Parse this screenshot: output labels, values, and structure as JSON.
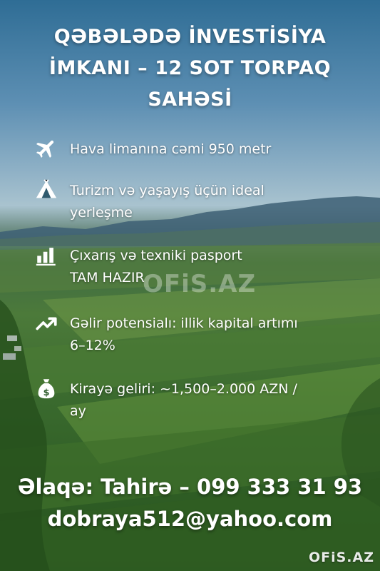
{
  "title": {
    "line1": "QƏBƏLƏDƏ İNVESTİSİYA",
    "line2": "İMKANI – 12 SOT TORPAQ",
    "line3": "SAHƏSİ"
  },
  "features": [
    {
      "icon": "airplane-icon",
      "lines": [
        "Hava limanına cəmi 950 metr"
      ]
    },
    {
      "icon": "tent-icon",
      "lines": [
        "Turizm və yaşayış üçün ideal",
        "yerleşme"
      ]
    },
    {
      "icon": "bar-chart-icon",
      "lines": [
        "Çıxarış və texniki pasport",
        "TAM HAZIR"
      ]
    },
    {
      "icon": "trend-up-icon",
      "lines": [
        "Gəlir potensialı: illik kapital artımı",
        "6–12%"
      ]
    },
    {
      "icon": "money-bag-icon",
      "lines": [
        "Kirayə geliri: ~1,500–2.000 AZN /",
        "ay"
      ]
    }
  ],
  "watermark": "OFiS.AZ",
  "contact": {
    "phone_line": "Əlaqə: Tahirə – 099 333 31 93",
    "email": "dobraya512@yahoo.com"
  },
  "logo": "OFiS.AZ"
}
